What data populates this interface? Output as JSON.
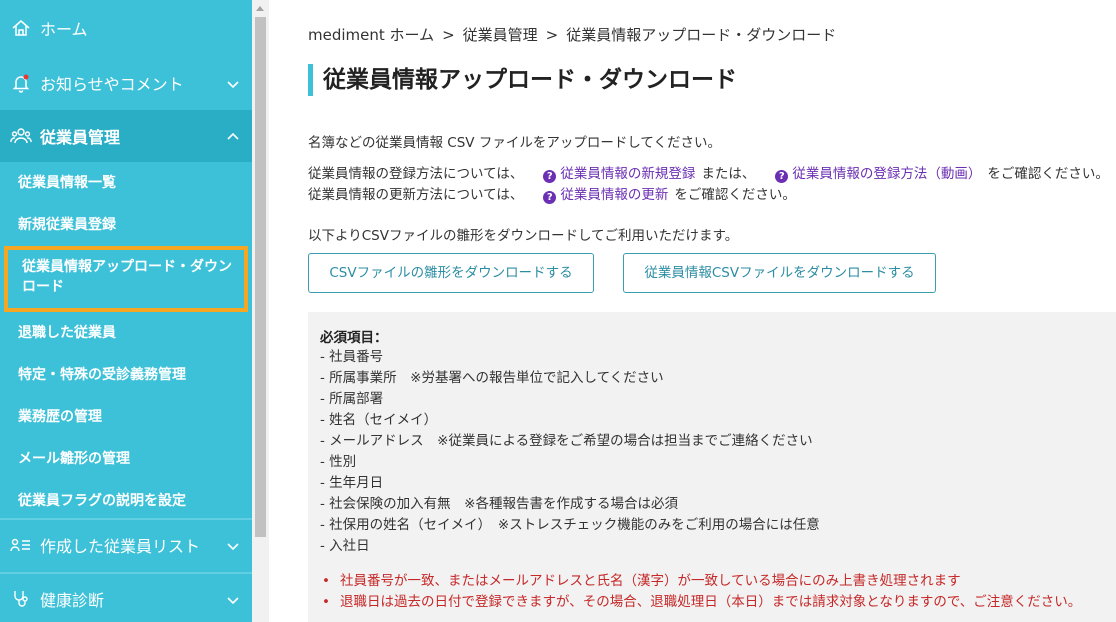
{
  "sidebar": {
    "home": "ホーム",
    "news": "お知らせやコメント",
    "employees": "従業員管理",
    "sub_items": [
      "従業員情報一覧",
      "新規従業員登録",
      "従業員情報アップロード・ダウンロード",
      "退職した従業員",
      "特定・特殊の受診義務管理",
      "業務歴の管理",
      "メール雛形の管理",
      "従業員フラグの説明を設定"
    ],
    "lists": "作成した従業員リスト",
    "checkup": "健康診断"
  },
  "breadcrumb": {
    "items": [
      "mediment ホーム",
      "従業員管理",
      "従業員情報アップロード・ダウンロード"
    ],
    "separator": ">"
  },
  "main": {
    "title": "従業員情報アップロード・ダウンロード",
    "intro": "名簿などの従業員情報 CSV ファイルをアップロードしてください。",
    "reg_prefix": "従業員情報の登録方法については、",
    "reg_link1": "従業員情報の新規登録",
    "reg_mid": "または、",
    "reg_link2": "従業員情報の登録方法（動画）",
    "reg_suffix": "をご確認ください。",
    "upd_prefix": "従業員情報の更新方法については、",
    "upd_link": "従業員情報の更新",
    "upd_suffix": "をご確認ください。",
    "download_intro": "以下よりCSVファイルの雛形をダウンロードしてご利用いただけます。",
    "btn_template": "CSVファイルの雛形をダウンロードする",
    "btn_employee_csv": "従業員情報CSVファイルをダウンロードする",
    "required_title": "必須項目：",
    "required_items": [
      "- 社員番号",
      "- 所属事業所　※労基署への報告単位で記入してください",
      "- 所属部署",
      "- 姓名（セイメイ）",
      "- メールアドレス　※従業員による登録をご希望の場合は担当までご連絡ください",
      "- 性別",
      "- 生年月日",
      "- 社会保険の加入有無　※各種報告書を作成する場合は必須",
      "- 社保用の姓名（セイメイ）　※ストレスチェック機能のみをご利用の場合には任意",
      "- 入社日"
    ],
    "notes": [
      "社員番号が一致、またはメールアドレスと氏名（漢字）が一致している場合にのみ上書き処理されます",
      "退職日は過去の日付で登録できますが、その場合、退職処理日（本日）までは請求対象となりますので、ご注意ください。"
    ]
  },
  "icons": {
    "home": "home-icon",
    "news": "bell-icon",
    "employees": "people-icon",
    "lists": "list-user-icon",
    "checkup": "stethoscope-icon",
    "help": "question-icon"
  },
  "colors": {
    "sidebar": "#3dc1d8",
    "sidebar_active": "#2aaec6",
    "highlight": "#f5a623",
    "link": "#6b2fb3",
    "note": "#c62828",
    "button_text": "#2c8ea4"
  }
}
